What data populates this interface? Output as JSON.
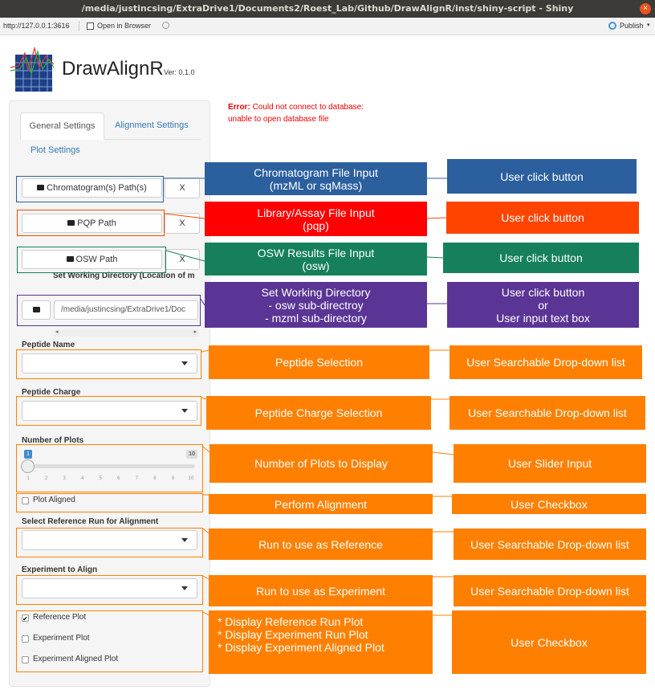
{
  "window": {
    "title": "/media/justincsing/ExtraDrive1/Documents2/Roest_Lab/Github/DrawAlignR/inst/shiny-script - Shiny",
    "close": "×"
  },
  "addressbar": {
    "url": "http://127.0.0.1:3616",
    "open_browser": "Open in Browser",
    "publish": "Publish"
  },
  "app": {
    "title": "DrawAlignR",
    "version": "Ver: 0.1.0",
    "error_label": "Error:",
    "error_line1": " Could not connect to database:",
    "error_line2": "unable to open database file"
  },
  "tabs": {
    "general": "General Settings",
    "alignment": "Alignment Settings",
    "plot": "Plot Settings"
  },
  "sidebar": {
    "chrom_button": "Chromatogram(s) Path(s)",
    "pqp_button": "PQP Path",
    "osw_button": "OSW Path",
    "clear": "X",
    "workdir_label": "Set Working Directory (Location of m",
    "workdir_value": "/media/justincsing/ExtraDrive1/Doc",
    "peptide_name_label": "Peptide Name",
    "peptide_charge_label": "Peptide Charge",
    "num_plots_label": "Number of Plots",
    "slider_min": "1",
    "slider_max": "10",
    "slider_value": 1,
    "slider_ticks": [
      "1",
      "2",
      "3",
      "4",
      "5",
      "6",
      "7",
      "8",
      "9",
      "10"
    ],
    "plot_aligned_label": "Plot Aligned",
    "ref_run_label": "Select Reference Run for Alignment",
    "exp_align_label": "Experiment to Align",
    "reference_plot_label": "Reference Plot",
    "experiment_plot_label": "Experiment Plot",
    "experiment_aligned_label": "Experiment Aligned Plot",
    "reference_plot_checked": true
  },
  "annotations": {
    "chrom": {
      "line1": "Chromatogram File Input",
      "line2": "(mzML or sqMass)",
      "action": "User click button"
    },
    "library": {
      "line1": "Library/Assay File Input",
      "line2": "(pqp)",
      "action": "User click button"
    },
    "osw": {
      "line1": "OSW Results File Input",
      "line2": "(osw)",
      "action": "User click button"
    },
    "workdir": {
      "line1": "Set Working Directory",
      "line2": "- osw sub-directroy",
      "line3": "- mzml sub-directory",
      "action1": "User click button",
      "action2": "or",
      "action3": "User input text box"
    },
    "peptide": {
      "label": "Peptide Selection",
      "action": "User Searchable Drop-down list"
    },
    "charge": {
      "label": "Peptide Charge Selection",
      "action": "User Searchable Drop-down list"
    },
    "numplots": {
      "label": "Number of Plots to Display",
      "action": "User Slider Input"
    },
    "align": {
      "label": "Perform Alignment",
      "action": "User Checkbox"
    },
    "reference": {
      "label": "Run to use as Reference",
      "action": "User Searchable Drop-down list"
    },
    "experiment": {
      "label": "Run to use as Experiment",
      "action": "User Searchable Drop-down list"
    },
    "display": {
      "line1": "* Display Reference Run Plot",
      "line2": "* Display Experiment Run Plot",
      "line3": "* Display Experiment Aligned  Plot",
      "action": "User Checkbox"
    }
  },
  "colors": {
    "blue": "#2b5f9e",
    "red": "#ff0000",
    "red_action": "#ff4400",
    "green": "#16805d",
    "purple": "#5a3595",
    "orange": "#ff8000"
  }
}
